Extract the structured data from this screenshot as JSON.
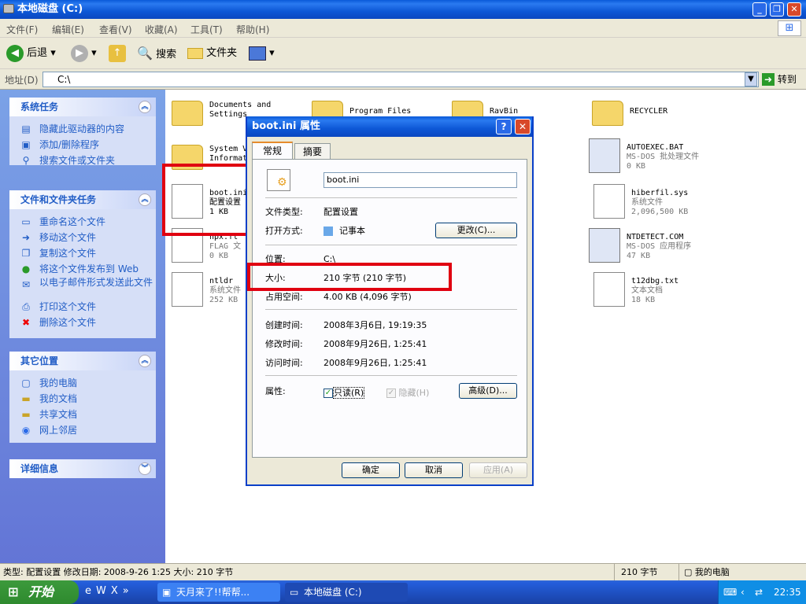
{
  "window": {
    "title": "本地磁盘 (C:)"
  },
  "menu": [
    "文件(F)",
    "编辑(E)",
    "查看(V)",
    "收藏(A)",
    "工具(T)",
    "帮助(H)"
  ],
  "toolbar": {
    "back": "后退",
    "search": "搜索",
    "folders": "文件夹"
  },
  "address": {
    "label": "地址(D)",
    "value": "C:\\",
    "go": "转到"
  },
  "system_tasks": {
    "title": "系统任务",
    "items": [
      "隐藏此驱动器的内容",
      "添加/删除程序",
      "搜索文件或文件夹"
    ]
  },
  "file_tasks": {
    "title": "文件和文件夹任务",
    "items": [
      "重命名这个文件",
      "移动这个文件",
      "复制这个文件",
      "将这个文件发布到 Web",
      "以电子邮件形式发送此文件",
      "打印这个文件",
      "删除这个文件"
    ]
  },
  "other_places": {
    "title": "其它位置",
    "items": [
      "我的电脑",
      "我的文档",
      "共享文档",
      "网上邻居"
    ]
  },
  "details": {
    "title": "详细信息"
  },
  "files": [
    {
      "name": "Documents and",
      "sub": "Settings",
      "size": "",
      "kind": "folder"
    },
    {
      "name": "Program Files",
      "sub": "",
      "size": "",
      "kind": "folder"
    },
    {
      "name": "RavBin",
      "sub": "",
      "size": "",
      "kind": "folder"
    },
    {
      "name": "RECYCLER",
      "sub": "",
      "size": "",
      "kind": "folder"
    },
    {
      "name": "System V",
      "sub": "Informat",
      "size": "",
      "kind": "folder"
    },
    {
      "name": "AUTOEXEC.BAT",
      "sub": "MS-DOS 批处理文件",
      "size": "0 KB",
      "kind": "bat"
    },
    {
      "name": "boot.ini",
      "sub": "配置设置",
      "size": "1 KB",
      "kind": "doc"
    },
    {
      "name": "hiberfil.sys",
      "sub": "系统文件",
      "size": "2,096,500 KB",
      "kind": "doc"
    },
    {
      "name": "hpx.fl",
      "sub": "FLAG 文",
      "size": "0 KB",
      "kind": "doc"
    },
    {
      "name": "NTDETECT.COM",
      "sub": "MS-DOS 应用程序",
      "size": "47 KB",
      "kind": "bat"
    },
    {
      "name": "ntldr",
      "sub": "系统文件",
      "size": "252 KB",
      "kind": "doc"
    },
    {
      "name": "t12dbg.txt",
      "sub": "文本文档",
      "size": "18 KB",
      "kind": "doc"
    }
  ],
  "dialog": {
    "title": "boot.ini 属性",
    "tabs": [
      "常规",
      "摘要"
    ],
    "filename": "boot.ini",
    "type_label": "文件类型:",
    "type_value": "配置设置",
    "open_label": "打开方式:",
    "open_value": "记事本",
    "change_btn": "更改(C)...",
    "loc_label": "位置:",
    "loc_value": "C:\\",
    "size_label": "大小:",
    "size_value": "210 字节 (210 字节)",
    "disk_label": "占用空间:",
    "disk_value": "4.00 KB (4,096 字节)",
    "created_label": "创建时间:",
    "created_value": "2008年3月6日, 19:19:35",
    "modified_label": "修改时间:",
    "modified_value": "2008年9月26日, 1:25:41",
    "accessed_label": "访问时间:",
    "accessed_value": "2008年9月26日, 1:25:41",
    "attr_label": "属性:",
    "readonly": "只读(R)",
    "hidden": "隐藏(H)",
    "advanced": "高级(D)...",
    "ok": "确定",
    "cancel": "取消",
    "apply": "应用(A)"
  },
  "statusbar": {
    "left": "类型: 配置设置 修改日期: 2008-9-26 1:25 大小: 210 字节",
    "mid": "210 字节",
    "right": "我的电脑"
  },
  "taskbar": {
    "start": "开始",
    "task1": "天月来了!!帮帮...",
    "task2": "本地磁盘 (C:)",
    "clock": "22:35"
  }
}
